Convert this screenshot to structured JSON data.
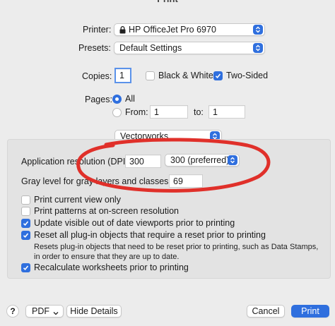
{
  "window": {
    "title": "Print"
  },
  "printer": {
    "label": "Printer:",
    "value": "HP OfficeJet Pro 6970"
  },
  "presets": {
    "label": "Presets:",
    "value": "Default Settings"
  },
  "copies": {
    "label": "Copies:",
    "value": "1",
    "black_white": "Black & White",
    "black_white_checked": false,
    "two_sided": "Two-Sided",
    "two_sided_checked": true
  },
  "pages": {
    "label": "Pages:",
    "all_label": "All",
    "from_label": "From:",
    "from_value": "1",
    "to_label": "to:",
    "to_value": "1"
  },
  "section_popup": {
    "value": "Vectorworks"
  },
  "vectorworks": {
    "resolution_label": "Application resolution (DPI):",
    "resolution_value": "300",
    "resolution_preset": "300 (preferred)",
    "gray_label": "Gray level for gray layers and classes:",
    "gray_value": "69",
    "options": [
      {
        "label": "Print current view only",
        "checked": false
      },
      {
        "label": "Print patterns at on-screen resolution",
        "checked": false
      },
      {
        "label": "Update visible out of date viewports prior to printing",
        "checked": true
      },
      {
        "label": "Reset all plug-in objects that require a reset prior to printing",
        "checked": true
      }
    ],
    "reset_note": "Resets plug-in objects that need to be reset prior to printing, such as Data Stamps, in order to ensure that they are up to date.",
    "recalc": {
      "label": "Recalculate worksheets prior to printing",
      "checked": true
    }
  },
  "footer": {
    "help": "?",
    "pdf": "PDF",
    "hide_details": "Hide Details",
    "cancel": "Cancel",
    "print": "Print"
  },
  "colors": {
    "accent": "#2f6fde",
    "annotation": "#e0302a",
    "panel": "#e3e3e3",
    "background": "#ececec"
  }
}
